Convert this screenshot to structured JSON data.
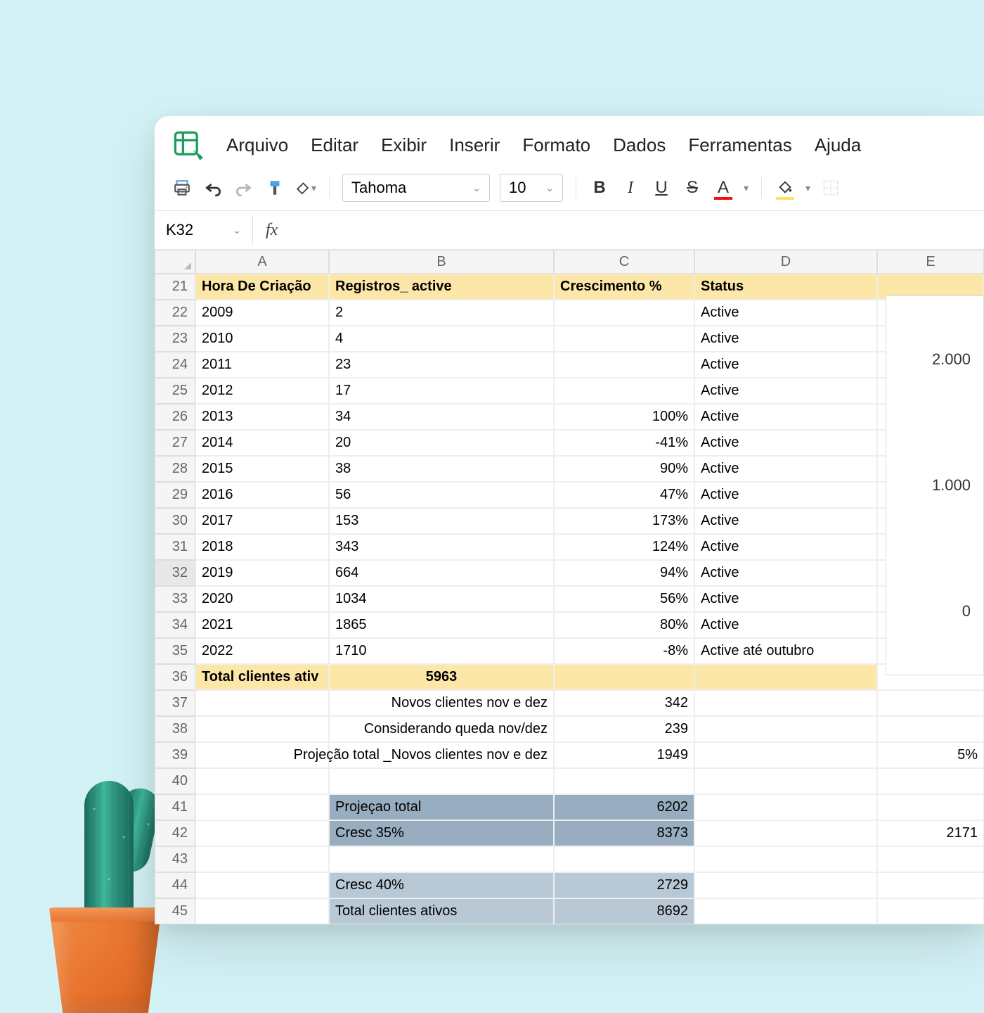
{
  "menus": [
    "Arquivo",
    "Editar",
    "Exibir",
    "Inserir",
    "Formato",
    "Dados",
    "Ferramentas",
    "Ajuda"
  ],
  "font": {
    "name": "Tahoma",
    "size": "10"
  },
  "namebox": "K32",
  "columns": [
    "A",
    "B",
    "C",
    "D",
    "E"
  ],
  "header_row": {
    "num": "21",
    "a": "Hora De Criação",
    "b": "Registros_ active",
    "c": "Crescimento %",
    "d": "Status"
  },
  "data_rows": [
    {
      "num": "22",
      "a": "2009",
      "b": "2",
      "c": "",
      "d": "Active"
    },
    {
      "num": "23",
      "a": "2010",
      "b": "4",
      "c": "",
      "d": "Active"
    },
    {
      "num": "24",
      "a": "2011",
      "b": "23",
      "c": "",
      "d": "Active"
    },
    {
      "num": "25",
      "a": "2012",
      "b": "17",
      "c": "",
      "d": "Active"
    },
    {
      "num": "26",
      "a": "2013",
      "b": "34",
      "c": "100%",
      "d": "Active"
    },
    {
      "num": "27",
      "a": "2014",
      "b": "20",
      "c": "-41%",
      "d": "Active"
    },
    {
      "num": "28",
      "a": "2015",
      "b": "38",
      "c": "90%",
      "d": "Active"
    },
    {
      "num": "29",
      "a": "2016",
      "b": "56",
      "c": "47%",
      "d": "Active"
    },
    {
      "num": "30",
      "a": "2017",
      "b": "153",
      "c": "173%",
      "d": "Active"
    },
    {
      "num": "31",
      "a": "2018",
      "b": "343",
      "c": "124%",
      "d": "Active"
    },
    {
      "num": "32",
      "a": "2019",
      "b": "664",
      "c": "94%",
      "d": "Active",
      "sel": true
    },
    {
      "num": "33",
      "a": "2020",
      "b": "1034",
      "c": "56%",
      "d": "Active"
    },
    {
      "num": "34",
      "a": "2021",
      "b": "1865",
      "c": "80%",
      "d": "Active"
    },
    {
      "num": "35",
      "a": "2022",
      "b": "1710",
      "c": "-8%",
      "d": "Active até outubro"
    }
  ],
  "total_row": {
    "num": "36",
    "a": "Total clientes ativ",
    "b": "5963"
  },
  "calc_rows": [
    {
      "num": "37",
      "b": "Novos clientes nov e dez",
      "c": "342"
    },
    {
      "num": "38",
      "b": "Considerando queda nov/dez",
      "c": "239"
    },
    {
      "num": "39",
      "b": "Projeção total _Novos clientes nov e dez",
      "c": "1949",
      "e": "5%"
    }
  ],
  "blank_row": "40",
  "proj_rows": [
    {
      "num": "41",
      "b": "Projeçao total",
      "c": "6202",
      "shade": "dark"
    },
    {
      "num": "42",
      "b": "Cresc 35%",
      "c": "8373",
      "e": "2171",
      "shade": "dark"
    }
  ],
  "blank_row2": "43",
  "proj_rows2": [
    {
      "num": "44",
      "b": "Cresc 40%",
      "c": "2729",
      "shade": "light"
    },
    {
      "num": "45",
      "b": "Total clientes ativos",
      "c": "8692",
      "shade": "light"
    }
  ],
  "chart_ticks": [
    "2.000",
    "1.000",
    "0"
  ]
}
